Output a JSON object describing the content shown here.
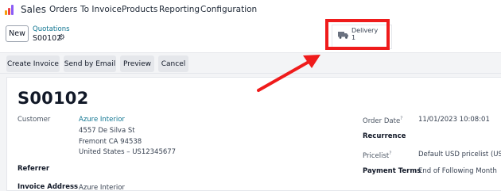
{
  "nav": {
    "app_name": "Sales",
    "items": [
      "Orders",
      "To Invoice",
      "Products",
      "Reporting",
      "Configuration"
    ]
  },
  "control": {
    "new_label": "New",
    "breadcrumb": "Quotations",
    "record": "S00102"
  },
  "smart_button": {
    "title": "Delivery",
    "count": "1",
    "icon": "truck-icon"
  },
  "actions": [
    "Create Invoice",
    "Send by Email",
    "Preview",
    "Cancel"
  ],
  "form": {
    "title": "S00102",
    "customer_label": "Customer",
    "customer_name": "Azure Interior",
    "address_line1": "4557 De Silva St",
    "address_line2": "Fremont CA 94538",
    "address_line3": "United States – US12345677",
    "referrer_label": "Referrer",
    "invoice_address_label": "Invoice Address",
    "invoice_address_value": "Azure Interior",
    "order_date_label": "Order Date",
    "order_date_value": "11/01/2023 10:08:01",
    "recurrence_label": "Recurrence",
    "pricelist_label": "Pricelist",
    "pricelist_value": "Default USD pricelist (USD)",
    "payment_terms_label": "Payment Terms",
    "payment_terms_value": "End of Following Month",
    "help_mark": "?"
  },
  "colors": {
    "highlight": "#ef1b1b",
    "link": "#0e7490"
  }
}
